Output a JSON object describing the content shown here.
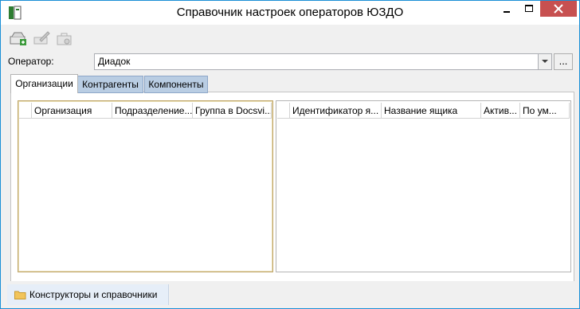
{
  "window": {
    "title": "Справочник настроек операторов ЮЗДО",
    "close_color": "#c75050",
    "border_color": "#1a8fd6"
  },
  "toolbar": {
    "buttons": [
      {
        "icon": "add-item-icon"
      },
      {
        "icon": "edit-icon"
      },
      {
        "icon": "delete-icon"
      }
    ]
  },
  "operator": {
    "label": "Оператор:",
    "value": "Диадок",
    "browse_label": "..."
  },
  "tabs": [
    {
      "label": "Организации",
      "active": true
    },
    {
      "label": "Контрагенты",
      "active": false
    },
    {
      "label": "Компоненты",
      "active": false
    }
  ],
  "left_grid": {
    "columns": [
      "Организация",
      "Подразделение...",
      "Группа в Docsvi..."
    ]
  },
  "right_grid": {
    "columns": [
      "Идентификатор я...",
      "Название ящика",
      "Актив...",
      "По ум..."
    ]
  },
  "status_bar": {
    "item_label": "Конструкторы и справочники"
  }
}
